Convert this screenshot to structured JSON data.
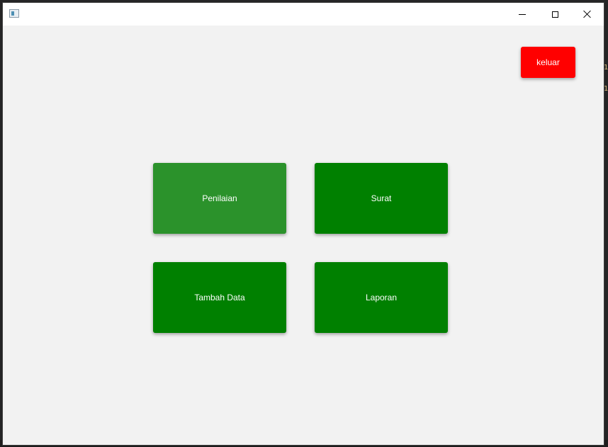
{
  "window": {
    "title": "",
    "controls": {
      "minimize_icon": "minimize-icon",
      "maximize_icon": "maximize-icon",
      "close_icon": "close-icon"
    }
  },
  "main": {
    "exit_button": {
      "label": "keluar",
      "color": "#ff0000"
    },
    "menu": [
      {
        "label": "Penilaian",
        "color": "#2b922b"
      },
      {
        "label": "Surat",
        "color": "#008000"
      },
      {
        "label": "Tambah Data",
        "color": "#008000"
      },
      {
        "label": "Laporan",
        "color": "#008000"
      }
    ]
  },
  "colors": {
    "background": "#f2f2f2",
    "titlebar": "#ffffff",
    "tile_green": "#008000",
    "tile_green_hover": "#2b922b",
    "exit_red": "#ff0000"
  }
}
